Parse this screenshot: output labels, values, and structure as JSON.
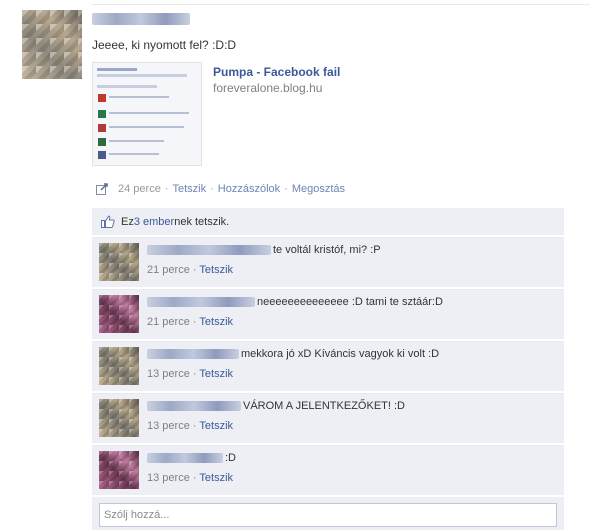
{
  "post": {
    "message": "Jeeee, ki nyomott fel? :D:D",
    "attachment": {
      "title": "Pumpa - Facebook fail",
      "domain": "foreveralone.blog.hu"
    },
    "meta": {
      "time": "24 perce",
      "like": "Tetszik",
      "comment": "Hozzászólok",
      "share": "Megosztás"
    },
    "likes": {
      "prefix": "Ez ",
      "link": "3 ember",
      "suffix": "nek tetszik."
    }
  },
  "comments": [
    {
      "text": "te voltál kristóf, mi? :P",
      "time": "21 perce",
      "like": "Tetszik"
    },
    {
      "text": "neeeeeeeeeeeeee :D tami te sztáár:D",
      "time": "21 perce",
      "like": "Tetszik"
    },
    {
      "text": "mekkora jó xD Kíváncis vagyok ki volt :D",
      "time": "13 perce",
      "like": "Tetszik"
    },
    {
      "text": "VÁROM A JELENTKEZŐKET! :D",
      "time": "13 perce",
      "like": "Tetszik"
    },
    {
      "text": ":D",
      "time": "13 perce",
      "like": "Tetszik"
    }
  ],
  "reply": {
    "placeholder": "Szólj hozzá..."
  },
  "colors": {
    "link": "#3b5998",
    "feedback_bg": "#edeff4"
  },
  "icons": {
    "share": "share-icon",
    "like": "thumbs-up-icon"
  }
}
